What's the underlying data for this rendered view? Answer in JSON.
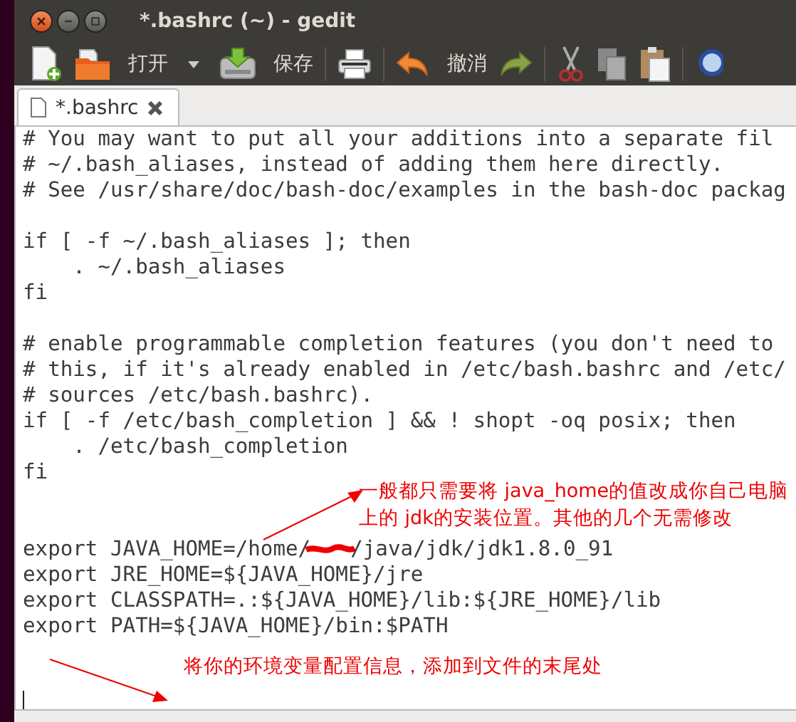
{
  "window": {
    "title": "*.bashrc (~) - gedit"
  },
  "toolbar": [
    {
      "kind": "new"
    },
    {
      "kind": "open",
      "label": "打开"
    },
    {
      "kind": "dropdown"
    },
    {
      "kind": "save",
      "label": "保存"
    },
    {
      "kind": "sep"
    },
    {
      "kind": "print"
    },
    {
      "kind": "sep"
    },
    {
      "kind": "undo",
      "label": "撤消"
    },
    {
      "kind": "redo"
    },
    {
      "kind": "sep"
    },
    {
      "kind": "cut"
    },
    {
      "kind": "copy"
    },
    {
      "kind": "paste"
    },
    {
      "kind": "sep"
    },
    {
      "kind": "search"
    }
  ],
  "tabs": [
    {
      "label": "*.bashrc",
      "selected": true
    }
  ],
  "editor": {
    "lines": [
      {
        "kind": "text",
        "text": "# You may want to put all your additions into a separate fil"
      },
      {
        "kind": "text",
        "text": "# ~/.bash_aliases, instead of adding them here directly."
      },
      {
        "kind": "text",
        "text": "# See /usr/share/doc/bash-doc/examples in the bash-doc packag"
      },
      {
        "kind": "blank"
      },
      {
        "kind": "text",
        "text": "if [ -f ~/.bash_aliases ]; then"
      },
      {
        "kind": "text",
        "text": "    . ~/.bash_aliases"
      },
      {
        "kind": "text",
        "text": "fi"
      },
      {
        "kind": "blank"
      },
      {
        "kind": "text",
        "text": "# enable programmable completion features (you don't need to"
      },
      {
        "kind": "text",
        "text": "# this, if it's already enabled in /etc/bash.bashrc and /etc/"
      },
      {
        "kind": "text",
        "text": "# sources /etc/bash.bashrc)."
      },
      {
        "kind": "text",
        "text": "if [ -f /etc/bash_completion ] && ! shopt -oq posix; then"
      },
      {
        "kind": "text",
        "text": "    . /etc/bash_completion"
      },
      {
        "kind": "text",
        "text": "fi"
      },
      {
        "kind": "blank"
      },
      {
        "kind": "blank"
      },
      {
        "kind": "redacted",
        "before": "export JAVA_HOME=/home/",
        "after": "/java/jdk/jdk1.8.0_91"
      },
      {
        "kind": "text",
        "text": "export JRE_HOME=${JAVA_HOME}/jre"
      },
      {
        "kind": "text",
        "text": "export CLASSPATH=.:${JAVA_HOME}/lib:${JRE_HOME}/lib"
      },
      {
        "kind": "text",
        "text": "export PATH=${JAVA_HOME}/bin:$PATH"
      },
      {
        "kind": "blank"
      },
      {
        "kind": "blank"
      },
      {
        "kind": "cursor"
      }
    ]
  },
  "annotations": [
    {
      "kind": "upper",
      "lines": [
        "一般都只需要将 java_home的值改成你自己电脑",
        "上的 jdk的安装位置。其他的几个无需修改"
      ]
    },
    {
      "kind": "lower",
      "lines": [
        "将你的环境变量配置信息，添加到文件的末尾处"
      ]
    }
  ]
}
